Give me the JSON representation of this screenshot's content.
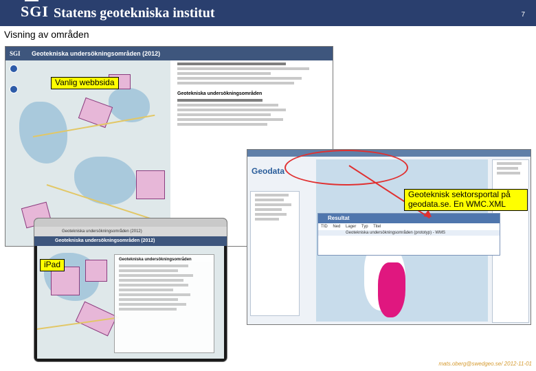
{
  "header": {
    "logo_text": "SGI",
    "org_name": "Statens geotekniska institut",
    "page_number": "7"
  },
  "slide": {
    "title": "Visning av områden"
  },
  "screenshots": {
    "web": {
      "app_title": "Geotekniska undersökningsområden (2012)",
      "sgi_mark": "SGI",
      "panel_heading": "Geotekniska undersökningsområden"
    },
    "portal": {
      "logo_text": "Geodata",
      "result_title": "Resultat",
      "result_columns": "TID Ned Lager Typ Titel",
      "result_row_title": "Geotekniska undersökningsområden (prototyp) - WMS"
    },
    "ipad": {
      "app_title": "Geotekniska undersökningsområden (2012)",
      "popup_heading": "Geotekniska undersökningsområden"
    }
  },
  "labels": {
    "web": "Vanlig webbsida",
    "ipad": "iPad",
    "portal": "Geoteknisk sektorsportal på geodata.se. En WMC.XML"
  },
  "footer": {
    "note": "mats.oberg@swedgeo.se/ 2012-11-01"
  },
  "colors": {
    "header_bg": "#2a3f6e",
    "label_bg": "#ffff00",
    "region_fill": "#e7b7d8",
    "accent_red": "#e03030",
    "footer_text": "#d59a2f"
  }
}
